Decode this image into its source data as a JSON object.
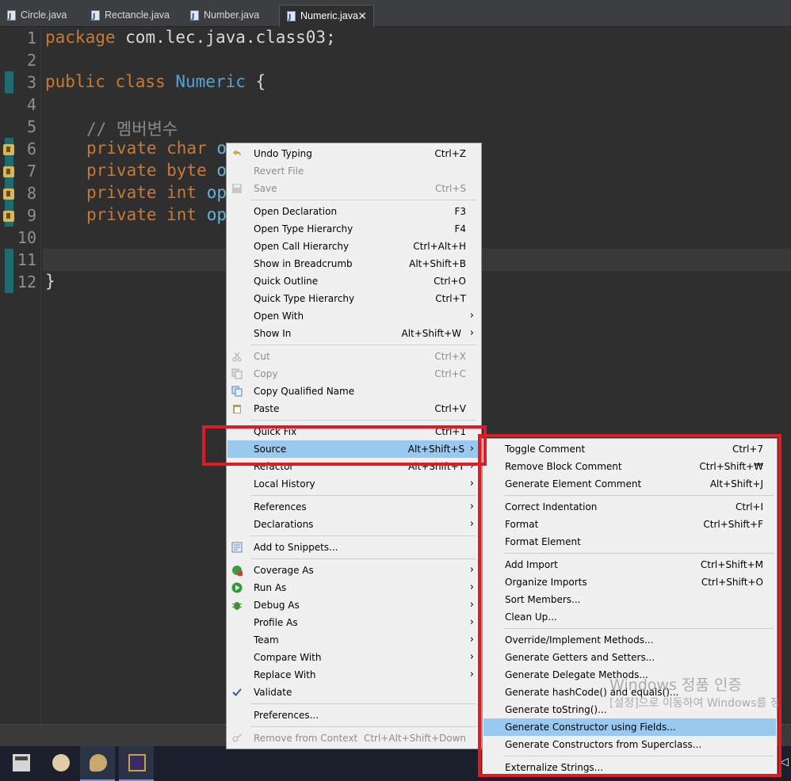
{
  "tabs": [
    {
      "label": "Circle.java",
      "active": false
    },
    {
      "label": "Rectancle.java",
      "active": false
    },
    {
      "label": "Number.java",
      "active": false
    },
    {
      "label": "Numeric.java",
      "active": true
    }
  ],
  "tab_close": "✕",
  "editor": {
    "line_numbers": [
      "1",
      "2",
      "3",
      "4",
      "5",
      "6",
      "7",
      "8",
      "9",
      "10",
      "11",
      "12"
    ],
    "code": {
      "l1_kw": "package",
      "l1_rest": " com.lec.java.class03;",
      "l3_kw": "public class",
      "l3_cls": "Numeric",
      "l3_rest": " {",
      "l5_comment": "// 멤버변수",
      "l6_kw": "private char",
      "l6_field": "o",
      "l7_kw": "private byte",
      "l7_field": "o",
      "l8_kw": "private int",
      "l8_field": "op",
      "l9_kw": "private int",
      "l9_field": "op",
      "l12_rest": "}"
    }
  },
  "context_menu": {
    "items": [
      {
        "label": "Undo Typing",
        "shortcut": "Ctrl+Z",
        "icon": "undo-icon"
      },
      {
        "label": "Revert File",
        "shortcut": "",
        "disabled": true
      },
      {
        "label": "Save",
        "shortcut": "Ctrl+S",
        "disabled": true,
        "icon": "save-icon"
      },
      {
        "label": "Open Declaration",
        "shortcut": "F3"
      },
      {
        "label": "Open Type Hierarchy",
        "shortcut": "F4"
      },
      {
        "label": "Open Call Hierarchy",
        "shortcut": "Ctrl+Alt+H"
      },
      {
        "label": "Show in Breadcrumb",
        "shortcut": "Alt+Shift+B"
      },
      {
        "label": "Quick Outline",
        "shortcut": "Ctrl+O"
      },
      {
        "label": "Quick Type Hierarchy",
        "shortcut": "Ctrl+T"
      },
      {
        "label": "Open With",
        "shortcut": "",
        "submenu": true
      },
      {
        "label": "Show In",
        "shortcut": "Alt+Shift+W",
        "submenu": true
      },
      {
        "label": "Cut",
        "shortcut": "Ctrl+X",
        "disabled": true,
        "icon": "scissors-icon"
      },
      {
        "label": "Copy",
        "shortcut": "Ctrl+C",
        "disabled": true,
        "icon": "copy-icon"
      },
      {
        "label": "Copy Qualified Name",
        "shortcut": "",
        "icon": "copy-qualified-icon"
      },
      {
        "label": "Paste",
        "shortcut": "Ctrl+V",
        "icon": "paste-icon"
      },
      {
        "label": "Quick Fix",
        "shortcut": "Ctrl+1"
      },
      {
        "label": "Source",
        "shortcut": "Alt+Shift+S",
        "submenu": true,
        "highlighted": true
      },
      {
        "label": "Refactor",
        "shortcut": "Alt+Shift+T",
        "submenu": true
      },
      {
        "label": "Local History",
        "shortcut": "",
        "submenu": true
      },
      {
        "label": "References",
        "shortcut": "",
        "submenu": true
      },
      {
        "label": "Declarations",
        "shortcut": "",
        "submenu": true
      },
      {
        "label": "Add to Snippets...",
        "shortcut": "",
        "icon": "snippet-icon"
      },
      {
        "label": "Coverage As",
        "shortcut": "",
        "submenu": true,
        "icon": "coverage-icon"
      },
      {
        "label": "Run As",
        "shortcut": "",
        "submenu": true,
        "icon": "run-icon"
      },
      {
        "label": "Debug As",
        "shortcut": "",
        "submenu": true,
        "icon": "bug-icon"
      },
      {
        "label": "Profile As",
        "shortcut": "",
        "submenu": true
      },
      {
        "label": "Team",
        "shortcut": "",
        "submenu": true
      },
      {
        "label": "Compare With",
        "shortcut": "",
        "submenu": true
      },
      {
        "label": "Replace With",
        "shortcut": "",
        "submenu": true
      },
      {
        "label": "Validate",
        "shortcut": "",
        "icon": "checkmark-icon"
      },
      {
        "label": "Preferences...",
        "shortcut": ""
      },
      {
        "label": "Remove from Context",
        "shortcut": "Ctrl+Alt+Shift+Down",
        "disabled": true,
        "icon": "remove-context-icon"
      }
    ],
    "submenu_arrow": "›"
  },
  "source_submenu": {
    "items": [
      {
        "label": "Toggle Comment",
        "shortcut": "Ctrl+7"
      },
      {
        "label": "Remove Block Comment",
        "shortcut": "Ctrl+Shift+₩"
      },
      {
        "label": "Generate Element Comment",
        "shortcut": "Alt+Shift+J"
      },
      {
        "label": "Correct Indentation",
        "shortcut": "Ctrl+I"
      },
      {
        "label": "Format",
        "shortcut": "Ctrl+Shift+F"
      },
      {
        "label": "Format Element",
        "shortcut": ""
      },
      {
        "label": "Add Import",
        "shortcut": "Ctrl+Shift+M"
      },
      {
        "label": "Organize Imports",
        "shortcut": "Ctrl+Shift+O"
      },
      {
        "label": "Sort Members...",
        "shortcut": ""
      },
      {
        "label": "Clean Up...",
        "shortcut": ""
      },
      {
        "label": "Override/Implement Methods...",
        "shortcut": ""
      },
      {
        "label": "Generate Getters and Setters...",
        "shortcut": ""
      },
      {
        "label": "Generate Delegate Methods...",
        "shortcut": ""
      },
      {
        "label": "Generate hashCode() and equals()...",
        "shortcut": ""
      },
      {
        "label": "Generate toString()...",
        "shortcut": ""
      },
      {
        "label": "Generate Constructor using Fields...",
        "shortcut": "",
        "highlighted": true
      },
      {
        "label": "Generate Constructors from Superclass...",
        "shortcut": ""
      },
      {
        "label": "Externalize Strings...",
        "shortcut": ""
      }
    ]
  },
  "watermark": {
    "line1": "Windows 정품 인증",
    "line2": "[설정]으로 이동하여 Windows를 정"
  },
  "taskbar": {
    "icons": [
      "calculator-icon",
      "paint-icon",
      "paint-palette-icon",
      "eclipse-icon"
    ],
    "tray": "volume-icon"
  }
}
